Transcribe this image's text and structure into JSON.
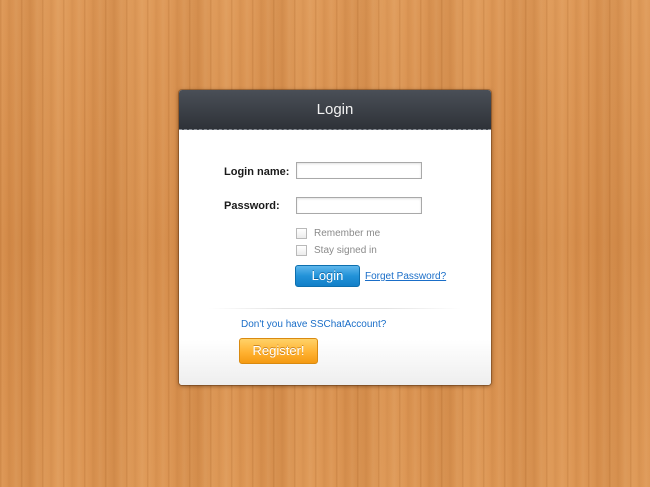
{
  "dialog": {
    "title": "Login"
  },
  "form": {
    "login_name_label": "Login name:",
    "password_label": "Password:",
    "login_name_value": "",
    "password_value": "",
    "remember_me_label": "Remember me",
    "remember_me_checked": false,
    "stay_signed_in_label": "Stay signed in",
    "stay_signed_in_checked": false,
    "login_button_label": "Login",
    "forgot_password_link": "Forget Password?"
  },
  "register": {
    "prompt": "Don't you have SSChatAccount?",
    "button_label": "Register!"
  },
  "colors": {
    "header": "#2e3238",
    "login_button": "#2292d8",
    "register_button": "#ffb232",
    "link": "#1a6ec8",
    "wood_background": "#d8914f"
  }
}
